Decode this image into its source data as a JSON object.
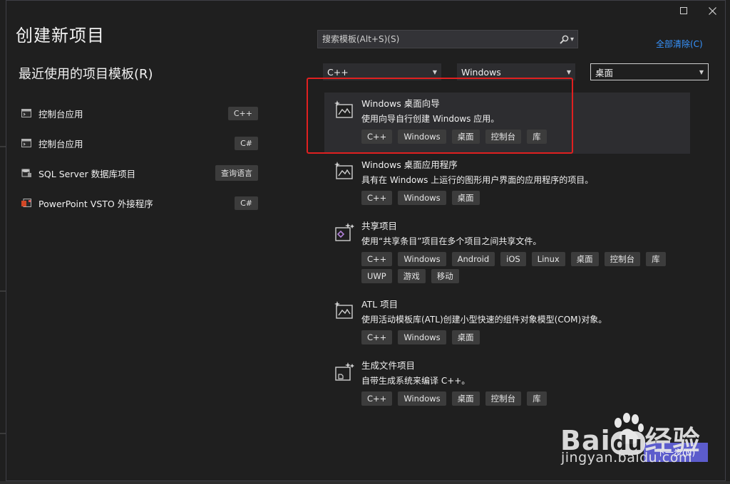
{
  "dialog": {
    "title": "创建新项目",
    "recent_title": "最近使用的项目模板(R)",
    "search_placeholder": "搜索模板(Alt+S)(S)",
    "clear_all": "全部清除(C)",
    "next_button": "下一步(N)"
  },
  "recent": [
    {
      "name": "控制台应用",
      "tag": "C++",
      "icon": "console-app-icon"
    },
    {
      "name": "控制台应用",
      "tag": "C#",
      "icon": "console-app-icon"
    },
    {
      "name": "SQL Server 数据库项目",
      "tag": "查询语言",
      "icon": "database-icon"
    },
    {
      "name": "PowerPoint VSTO 外接程序",
      "tag": "C#",
      "icon": "powerpoint-icon"
    }
  ],
  "filters": {
    "language": "C++",
    "platform": "Windows",
    "project_type": "桌面"
  },
  "templates": [
    {
      "name": "Windows 桌面向导",
      "desc": "使用向导自行创建 Windows 应用。",
      "tags": [
        "C++",
        "Windows",
        "桌面",
        "控制台",
        "库"
      ],
      "icon": "wizard-icon"
    },
    {
      "name": "Windows 桌面应用程序",
      "desc": "具有在 Windows 上运行的图形用户界面的应用程序的项目。",
      "tags": [
        "C++",
        "Windows",
        "桌面"
      ],
      "icon": "desktop-app-icon"
    },
    {
      "name": "共享项目",
      "desc": "使用“共享条目”项目在多个项目之间共享文件。",
      "tags": [
        "C++",
        "Windows",
        "Android",
        "iOS",
        "Linux",
        "桌面",
        "控制台",
        "库",
        "UWP",
        "游戏",
        "移动"
      ],
      "icon": "shared-project-icon"
    },
    {
      "name": "ATL 项目",
      "desc": "使用活动模板库(ATL)创建小型快速的组件对象模型(COM)对象。",
      "tags": [
        "C++",
        "Windows",
        "桌面"
      ],
      "icon": "atl-project-icon"
    },
    {
      "name": "生成文件项目",
      "desc": "自带生成系统来编译 C++。",
      "tags": [
        "C++",
        "Windows",
        "桌面",
        "控制台",
        "库"
      ],
      "icon": "makefile-project-icon"
    }
  ],
  "watermark": {
    "logo_a": "Bai",
    "logo_b": "du",
    "logo_c": "经验",
    "url": "jingyan.baidu.com"
  },
  "colors": {
    "accent": "#5c5ccc",
    "link": "#3794ff",
    "highlight": "#e02020"
  }
}
